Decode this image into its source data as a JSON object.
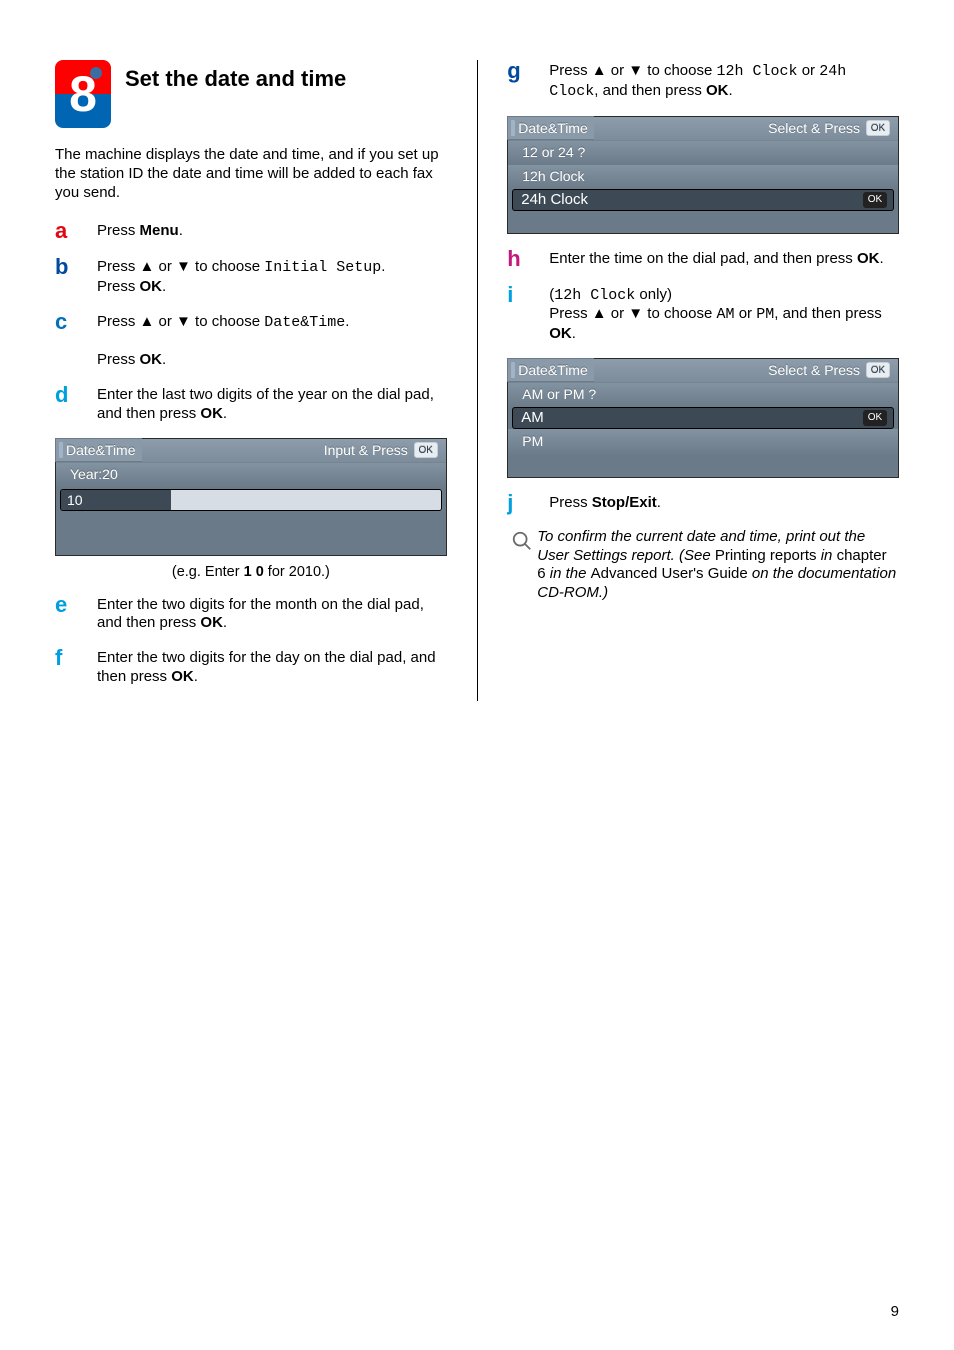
{
  "section": {
    "number": "8",
    "title": "Set the date and time"
  },
  "intro": "The machine displays the date and time, and if you set up the station ID the date and time will be added to each fax you send.",
  "steps": {
    "a": {
      "pre": "Press ",
      "key": "Menu",
      "post": "."
    },
    "b": {
      "pre": "Press ▲ or ▼ to choose ",
      "code": "Initial Setup",
      "post1": ".",
      "line2a": "Press ",
      "key": "OK",
      "post2": "."
    },
    "c": {
      "pre": "Press ▲ or ▼ to choose ",
      "code": "Date&Time",
      "post1": ".",
      "line2a": "Press ",
      "key": "OK",
      "post2": "."
    },
    "d": {
      "text1": "Enter the last two digits of the year on the dial pad, and then press ",
      "key": "OK",
      "post": "."
    },
    "e": {
      "text1": "Enter the two digits for the month on the dial pad, and then press ",
      "key": "OK",
      "post": "."
    },
    "f": {
      "text1": "Enter the two digits for the day on the dial pad, and then press ",
      "key": "OK",
      "post": "."
    },
    "g": {
      "pre": "Press ▲ or ▼ to choose ",
      "code1": "12h Clock",
      "mid": " or ",
      "code2": "24h Clock",
      "post1": ", and then press ",
      "key": "OK",
      "post2": "."
    },
    "h": {
      "text1": "Enter the time on the dial pad, and then press ",
      "key": "OK",
      "post": "."
    },
    "i": {
      "code": "12h Clock",
      "only": " only)",
      "line2": "Press ▲ or ▼ to choose ",
      "codeA": "AM",
      "mid": " or ",
      "codeB": "PM",
      "post1": ", and then press ",
      "key": "OK",
      "post2": "."
    },
    "j": {
      "pre": "Press ",
      "key": "Stop/Exit",
      "post": "."
    }
  },
  "lcd1": {
    "title": "Date&Time",
    "hint": "Input & Press",
    "ok": "OK",
    "row2": "Year:20",
    "input": "10"
  },
  "caption1": {
    "pre": "(e.g. Enter ",
    "bold": "1 0",
    "post": " for 2010.)"
  },
  "lcd2": {
    "title": "Date&Time",
    "hint": "Select & Press",
    "ok": "OK",
    "row2": "12 or 24 ?",
    "row3": "12h Clock",
    "row4": "24h Clock",
    "okdark": "OK"
  },
  "lcd3": {
    "title": "Date&Time",
    "hint": "Select & Press",
    "ok": "OK",
    "row2": "AM or PM ?",
    "row3": "AM",
    "okdark": "OK",
    "row4": "PM"
  },
  "tip": {
    "t1": "To confirm the current date and time, print out the User Settings report. (See ",
    "r1": "Printing reports",
    "t2": " in ",
    "r2": "chapter 6",
    "t3": " in the ",
    "r3": "Advanced User's Guide",
    "t4": " on the documentation CD-ROM.)"
  },
  "page": "9"
}
